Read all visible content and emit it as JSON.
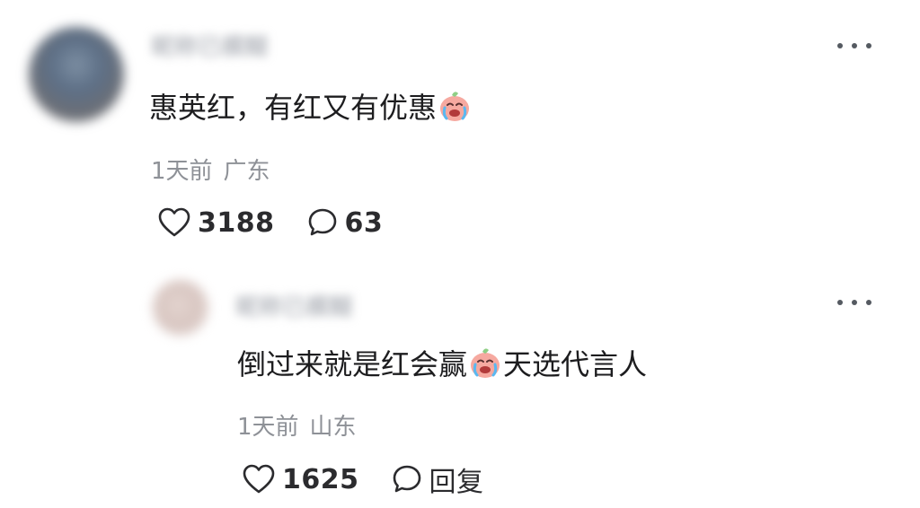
{
  "comment": {
    "username": "昵称已模糊",
    "text": "惠英红，有红又有优惠",
    "emoji": "crying-face-emoji",
    "time": "1天前",
    "location": "广东",
    "like_count": "3188",
    "reply_count": "63"
  },
  "reply": {
    "username": "昵称已模糊",
    "text_before_emoji": "倒过来就是红会赢",
    "emoji": "crying-face-emoji",
    "text_after_emoji": "天选代言人",
    "time": "1天前",
    "location": "山东",
    "like_count": "1625",
    "reply_label": "回复"
  },
  "icons": {
    "more": "more-horizontal-icon",
    "like": "heart-outline-icon",
    "reply": "speech-bubble-icon"
  },
  "colors": {
    "text_primary": "#1d1d1f",
    "text_meta": "#8e9197",
    "icon": "#2b2b2e"
  }
}
